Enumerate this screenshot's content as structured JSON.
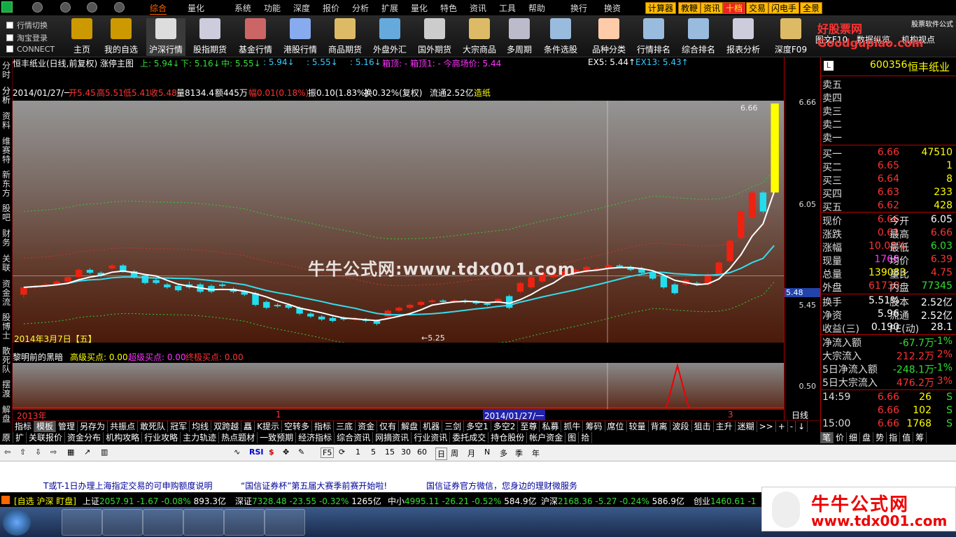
{
  "menubar": {
    "items": [
      "综合",
      "量化",
      "系统",
      "功能",
      "深度",
      "报价",
      "分析",
      "扩展",
      "量化",
      "特色",
      "资讯",
      "工具",
      "帮助",
      "换行",
      "换资"
    ],
    "buttons": [
      "计算器",
      "教鞭",
      "资讯",
      "十档",
      "交易",
      "闪电手",
      "全景"
    ],
    "promo_title": "好股票网Goodgupiao.com",
    "promo_sub": "股票软件公式"
  },
  "toolbar": {
    "checks": [
      "行情切换",
      "淘宝登录",
      "CONNECT"
    ],
    "items": [
      "主页",
      "我的自选",
      "沪深行情",
      "股指期货",
      "基金行情",
      "港股行情",
      "商品期货",
      "外盘外汇",
      "国外期货",
      "大宗商品",
      "多周期",
      "条件选股",
      "品种分类",
      "行情排名",
      "综合排名",
      "报表分析",
      "深度F09",
      "图文F10",
      "数据纵览",
      "机构视点"
    ]
  },
  "lefttabs": [
    "分时",
    "分析",
    "资料",
    "维赛特",
    "新东方",
    "股吧",
    "财务",
    "关联",
    "资金流",
    "股博士",
    "散死队",
    "摆渡",
    "解盘"
  ],
  "chart": {
    "title": "恒丰纸业(日线,前复权) 涨停主图",
    "up": "上: 5.94↓",
    "down": "下: 5.16↓",
    "mid": "中: 5.55↓",
    "v1": ": 5.94↓",
    "v2": ": 5.55↓",
    "v3": ": 5.16↓",
    "box": "箱顶: - 箱顶1: - 今高场价: 5.44",
    "ex5": "EX5: 5.44↑",
    "ex13": "EX13: 5.43↑",
    "bar_info_date": "2014/01/27/一",
    "bar_open": "开5.45",
    "bar_high": "高5.51",
    "bar_low": "低5.41",
    "bar_close": "收5.48",
    "bar_vol": "量8134.4",
    "bar_amt": "额445万",
    "bar_rng": "幅0.01(0.18%)",
    "bar_amp": "振0.10(1.83%)",
    "bar_turn": "换0.32%(复权)",
    "bar_float": "流通2.52亿",
    "bar_ind": "造纸",
    "peak_label": "6.66",
    "low_label": "←5.25",
    "date_label": "2014年3月7日【五】",
    "cursor_price": "5.48",
    "watermark": "牛牛公式网:www.tdx001.com",
    "indicator_name": "黎明前的黑暗",
    "ind_a": "高级买点: 0.00",
    "ind_b": "超级买点: 0.00",
    "ind_c": "终极买点: 0.00",
    "axis_left": "2013年",
    "axis_mid": "1",
    "axis_date": "2014/01/27/一",
    "axis_right": "3",
    "right_ticks": [
      "6.66",
      "6.05",
      "5.45"
    ],
    "sub_tick": "0.50",
    "daily_label": "日线",
    "candles": [
      {
        "o": 5.35,
        "c": 5.4,
        "h": 5.41,
        "l": 5.33
      },
      {
        "o": 5.4,
        "c": 5.41,
        "h": 5.42,
        "l": 5.39
      },
      {
        "o": 5.41,
        "c": 5.42,
        "h": 5.43,
        "l": 5.4
      },
      {
        "o": 5.42,
        "c": 5.44,
        "h": 5.45,
        "l": 5.41
      },
      {
        "o": 5.44,
        "c": 5.47,
        "h": 5.48,
        "l": 5.43
      },
      {
        "o": 5.47,
        "c": 5.52,
        "h": 5.53,
        "l": 5.46
      },
      {
        "o": 5.52,
        "c": 5.5,
        "h": 5.53,
        "l": 5.49
      },
      {
        "o": 5.5,
        "c": 5.48,
        "h": 5.51,
        "l": 5.47
      },
      {
        "o": 5.53,
        "c": 5.55,
        "h": 5.56,
        "l": 5.52
      },
      {
        "o": 5.55,
        "c": 5.51,
        "h": 5.56,
        "l": 5.5
      },
      {
        "o": 5.51,
        "c": 5.47,
        "h": 5.52,
        "l": 5.46
      },
      {
        "o": 5.48,
        "c": 5.43,
        "h": 5.49,
        "l": 5.42
      },
      {
        "o": 5.45,
        "c": 5.43,
        "h": 5.46,
        "l": 5.42
      },
      {
        "o": 5.42,
        "c": 5.4,
        "h": 5.43,
        "l": 5.39
      },
      {
        "o": 5.41,
        "c": 5.38,
        "h": 5.42,
        "l": 5.37
      },
      {
        "o": 5.42,
        "c": 5.4,
        "h": 5.44,
        "l": 5.39
      },
      {
        "o": 5.42,
        "c": 5.37,
        "h": 5.43,
        "l": 5.36
      },
      {
        "o": 5.41,
        "c": 5.37,
        "h": 5.42,
        "l": 5.36
      },
      {
        "o": 5.42,
        "c": 5.41,
        "h": 5.43,
        "l": 5.4
      },
      {
        "o": 5.39,
        "c": 5.37,
        "h": 5.4,
        "l": 5.36
      },
      {
        "o": 5.37,
        "c": 5.35,
        "h": 5.38,
        "l": 5.34
      },
      {
        "o": 5.36,
        "c": 5.28,
        "h": 5.37,
        "l": 5.27
      },
      {
        "o": 5.3,
        "c": 5.26,
        "h": 5.31,
        "l": 5.25
      },
      {
        "o": 5.28,
        "c": 5.27,
        "h": 5.29,
        "l": 5.26
      },
      {
        "o": 5.28,
        "c": 5.26,
        "h": 5.29,
        "l": 5.25
      },
      {
        "o": 5.26,
        "c": 5.22,
        "h": 5.27,
        "l": 5.21
      },
      {
        "o": 5.22,
        "c": 5.2,
        "h": 5.23,
        "l": 5.19
      },
      {
        "o": 5.2,
        "c": 5.18,
        "h": 5.21,
        "l": 5.17
      },
      {
        "o": 5.19,
        "c": 5.17,
        "h": 5.2,
        "l": 5.16
      },
      {
        "o": 5.19,
        "c": 5.18,
        "h": 5.2,
        "l": 5.17
      },
      {
        "o": 5.18,
        "c": 5.19,
        "h": 5.2,
        "l": 5.17
      },
      {
        "o": 5.18,
        "c": 5.17,
        "h": 5.19,
        "l": 5.16
      },
      {
        "o": 5.17,
        "c": 5.15,
        "h": 5.18,
        "l": 5.14
      },
      {
        "o": 5.2,
        "c": 5.24,
        "h": 5.25,
        "l": 5.19
      },
      {
        "o": 5.24,
        "c": 5.26,
        "h": 5.27,
        "l": 5.23
      },
      {
        "o": 5.26,
        "c": 5.28,
        "h": 5.29,
        "l": 5.25
      },
      {
        "o": 5.28,
        "c": 5.3,
        "h": 5.31,
        "l": 5.27
      },
      {
        "o": 5.3,
        "c": 5.31,
        "h": 5.32,
        "l": 5.29
      },
      {
        "o": 5.31,
        "c": 5.3,
        "h": 5.32,
        "l": 5.29
      },
      {
        "o": 5.3,
        "c": 5.31,
        "h": 5.32,
        "l": 5.29
      },
      {
        "o": 5.31,
        "c": 5.3,
        "h": 5.32,
        "l": 5.29
      },
      {
        "o": 5.3,
        "c": 5.29,
        "h": 5.31,
        "l": 5.28
      },
      {
        "o": 5.29,
        "c": 5.28,
        "h": 5.3,
        "l": 5.27
      },
      {
        "o": 5.3,
        "c": 5.32,
        "h": 5.33,
        "l": 5.29
      },
      {
        "o": 5.34,
        "c": 5.26,
        "h": 5.35,
        "l": 5.25
      },
      {
        "o": 5.37,
        "c": 5.43,
        "h": 5.44,
        "l": 5.36
      },
      {
        "o": 5.4,
        "c": 5.47,
        "h": 5.48,
        "l": 5.39
      },
      {
        "o": 5.44,
        "c": 5.5,
        "h": 5.51,
        "l": 5.43
      },
      {
        "o": 5.47,
        "c": 5.49,
        "h": 5.5,
        "l": 5.46
      },
      {
        "o": 5.48,
        "c": 5.51,
        "h": 5.52,
        "l": 5.47
      },
      {
        "o": 5.5,
        "c": 5.52,
        "h": 5.53,
        "l": 5.49
      },
      {
        "o": 5.51,
        "c": 5.54,
        "h": 5.55,
        "l": 5.5
      },
      {
        "o": 5.52,
        "c": 5.53,
        "h": 5.54,
        "l": 5.51
      },
      {
        "o": 5.53,
        "c": 5.55,
        "h": 5.56,
        "l": 5.52
      },
      {
        "o": 5.55,
        "c": 5.54,
        "h": 5.56,
        "l": 5.53
      },
      {
        "o": 5.54,
        "c": 5.52,
        "h": 5.55,
        "l": 5.51
      },
      {
        "o": 5.53,
        "c": 5.5,
        "h": 5.54,
        "l": 5.49
      },
      {
        "o": 5.5,
        "c": 5.46,
        "h": 5.51,
        "l": 5.45
      },
      {
        "o": 5.48,
        "c": 5.4,
        "h": 5.49,
        "l": 5.39
      },
      {
        "o": 5.42,
        "c": 5.36,
        "h": 5.43,
        "l": 5.35
      },
      {
        "o": 5.42,
        "c": 5.45,
        "h": 5.46,
        "l": 5.41
      },
      {
        "o": 5.43,
        "c": 5.42,
        "h": 5.44,
        "l": 5.41
      },
      {
        "o": 5.42,
        "c": 5.49,
        "h": 5.5,
        "l": 5.41
      },
      {
        "o": 5.49,
        "c": 5.57,
        "h": 5.58,
        "l": 5.48
      },
      {
        "o": 5.58,
        "c": 5.72,
        "h": 5.73,
        "l": 5.57
      },
      {
        "o": 5.74,
        "c": 5.92,
        "h": 5.93,
        "l": 5.73
      },
      {
        "o": 5.88,
        "c": 6.05,
        "h": 6.06,
        "l": 5.87
      },
      {
        "o": 6.05,
        "c": 5.92,
        "h": 6.06,
        "l": 5.91
      },
      {
        "o": 6.05,
        "c": 6.66,
        "h": 6.66,
        "l": 6.05
      }
    ]
  },
  "quote": {
    "code": "600356",
    "name": "恒丰纸业",
    "flag": "L",
    "sell": [
      "卖五",
      "卖四",
      "卖三",
      "卖二",
      "卖一"
    ],
    "buy": [
      {
        "label": "买一",
        "price": "6.66",
        "vol": "47510"
      },
      {
        "label": "买二",
        "price": "6.65",
        "vol": "1"
      },
      {
        "label": "买三",
        "price": "6.64",
        "vol": "8"
      },
      {
        "label": "买四",
        "price": "6.63",
        "vol": "233"
      },
      {
        "label": "买五",
        "price": "6.62",
        "vol": "428"
      }
    ],
    "stats": [
      {
        "l": "现价",
        "v": "6.66",
        "l2": "今开",
        "v2": "6.05"
      },
      {
        "l": "涨跌",
        "v": "0.61",
        "l2": "最高",
        "v2": "6.66"
      },
      {
        "l": "涨幅",
        "v": "10.08%",
        "l2": "最低",
        "v2": "6.03"
      },
      {
        "l": "现量",
        "v": "1768",
        "l2": "均价",
        "v2": "6.39"
      },
      {
        "l": "总量",
        "v": "139083",
        "l2": "量比",
        "v2": "4.75"
      },
      {
        "l": "外盘",
        "v": "61738",
        "l2": "内盘",
        "v2": "77345"
      }
    ],
    "fund": [
      {
        "l": "换手",
        "v": "5.51%",
        "l2": "股本",
        "v2": "2.52亿"
      },
      {
        "l": "净资",
        "v": "5.96",
        "l2": "流通",
        "v2": "2.52亿"
      },
      {
        "l": "收益(三)",
        "v": "0.190",
        "l2": "PE(动)",
        "v2": "28.1"
      }
    ],
    "flow": [
      {
        "l": "净流入额",
        "v": "-67.7万",
        "p": "-1%"
      },
      {
        "l": "大宗流入",
        "v": "212.2万",
        "p": "2%"
      },
      {
        "l": "5日净流入额",
        "v": "-248.1万",
        "p": "-1%"
      },
      {
        "l": "5日大宗流入",
        "v": "476.2万",
        "p": "3%"
      }
    ],
    "ticks": [
      {
        "t": "14:59",
        "p": "6.66",
        "v": "26",
        "s": "S"
      },
      {
        "t": "",
        "p": "6.66",
        "v": "102",
        "s": "S"
      },
      {
        "t": "15:00",
        "p": "6.66",
        "v": "1768",
        "s": "S"
      }
    ],
    "tabs": [
      "笔",
      "价",
      "细",
      "盘",
      "势",
      "指",
      "值",
      "筹"
    ]
  },
  "tabs1": [
    "指标",
    "模板",
    "管理",
    "另存为",
    "共振点",
    "敢死队",
    "冠军",
    "均线",
    "双跨越",
    "矗",
    "K提示",
    "空转多",
    "指标",
    "三底",
    "资金",
    "仅有",
    "解盘",
    "机器",
    "三剑",
    "多空1",
    "多空2",
    "至尊",
    "私募",
    "抓牛",
    "筹码",
    "席位",
    "较量",
    "背离",
    "波段",
    "狙击",
    "主升",
    "迷糊",
    ">>",
    "+",
    "-",
    "↓"
  ],
  "tabs2": [
    "原",
    "扩",
    "关联报价",
    "资金分布",
    "机构攻略",
    "行业攻略",
    "主力轨迹",
    "热点题材",
    "一致预期",
    "经济指标",
    "综合资讯",
    "网摘资讯",
    "行业资讯",
    "委托成交",
    "持仓股份",
    "帐户资金",
    "图",
    "拾"
  ],
  "toolnums": [
    "F5",
    "1",
    "5",
    "15",
    "30",
    "60",
    "日",
    "周",
    "月",
    "N",
    "多",
    "季",
    "年"
  ],
  "news": [
    "T或T-1日办理上海指定交易的可申购额度说明",
    "“国信证券杯”第五届大赛季前赛开始啦!",
    "国信证券官方微信，您身边的理财微服务"
  ],
  "indexbar": {
    "head": "[自选 沪深 盯盘]",
    "items": [
      {
        "n": "上证",
        "v": "2057.91",
        "c": "-1.67",
        "p": "-0.08%",
        "a": "893.3亿"
      },
      {
        "n": "深证",
        "v": "7328.48",
        "c": "-23.55",
        "p": "-0.32%",
        "a": "1265亿"
      },
      {
        "n": "中小",
        "v": "4995.11",
        "c": "-26.21",
        "p": "-0.52%",
        "a": "584.9亿"
      },
      {
        "n": "沪深",
        "v": "2168.36",
        "c": "-5.27",
        "p": "-0.24%",
        "a": "586.9亿"
      },
      {
        "n": "创业",
        "v": "1460.61",
        "c": "-1",
        "p": "",
        "a": ""
      }
    ]
  },
  "adbox": {
    "title": "牛牛公式网",
    "url": "www.tdx001.com"
  }
}
